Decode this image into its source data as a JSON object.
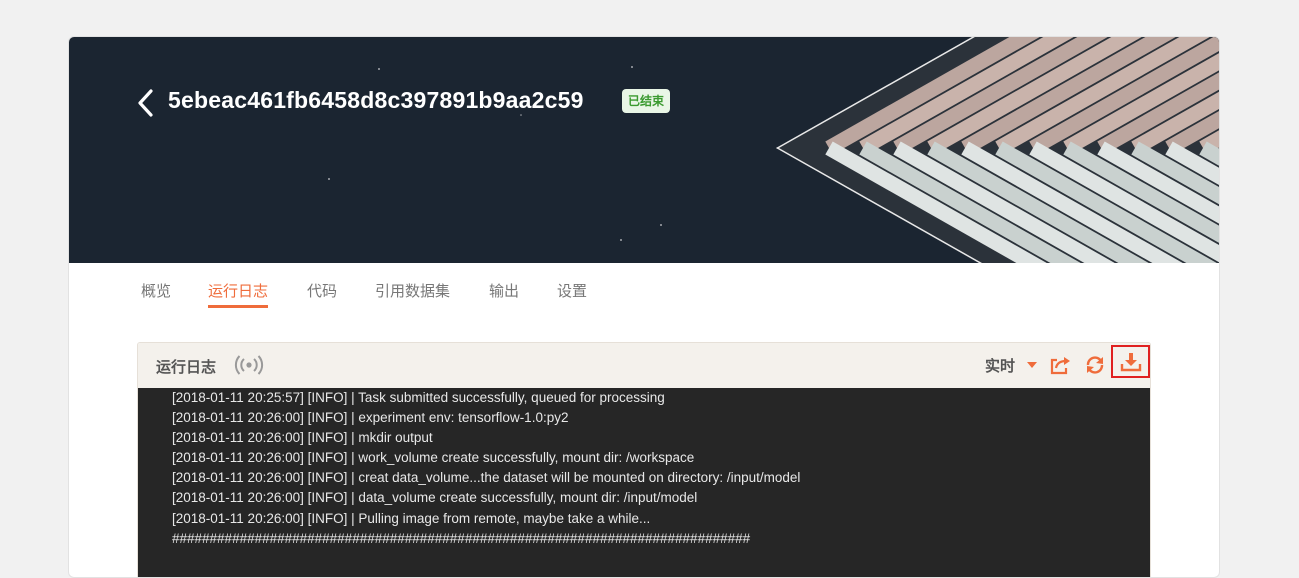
{
  "job": {
    "title": "5ebeac461fb6458d8c397891b9aa2c59",
    "status": "已结束"
  },
  "tabs": [
    {
      "label": "概览",
      "active": false
    },
    {
      "label": "运行日志",
      "active": true
    },
    {
      "label": "代码",
      "active": false
    },
    {
      "label": "引用数据集",
      "active": false
    },
    {
      "label": "输出",
      "active": false
    },
    {
      "label": "设置",
      "active": false
    }
  ],
  "log": {
    "header_label": "运行日志",
    "mode_label": "实时",
    "icons": [
      "broadcast-icon",
      "caret-down-icon",
      "share-icon",
      "refresh-icon",
      "download-icon"
    ],
    "lines": [
      "[2018-01-11 20:25:57] [INFO] | Task submitted successfully, queued for processing",
      "[2018-01-11 20:26:00] [INFO] | experiment env: tensorflow-1.0:py2",
      "[2018-01-11 20:26:00] [INFO] | mkdir output",
      "[2018-01-11 20:26:00] [INFO] | work_volume create successfully, mount dir: /workspace",
      "[2018-01-11 20:26:00] [INFO] | creat data_volume...the dataset will be mounted on directory: /input/model",
      "[2018-01-11 20:26:00] [INFO] | data_volume create successfully, mount dir: /input/model",
      "[2018-01-11 20:26:00] [INFO] | Pulling image from remote, maybe take a while...",
      "#############################################################################"
    ]
  },
  "colors": {
    "accent": "#ef6c3b",
    "banner_bg": "#1b2531",
    "status_bg": "#e9f6e6",
    "status_text": "#3a9a2f",
    "highlight_border": "#e02020",
    "log_bg": "#262626"
  }
}
